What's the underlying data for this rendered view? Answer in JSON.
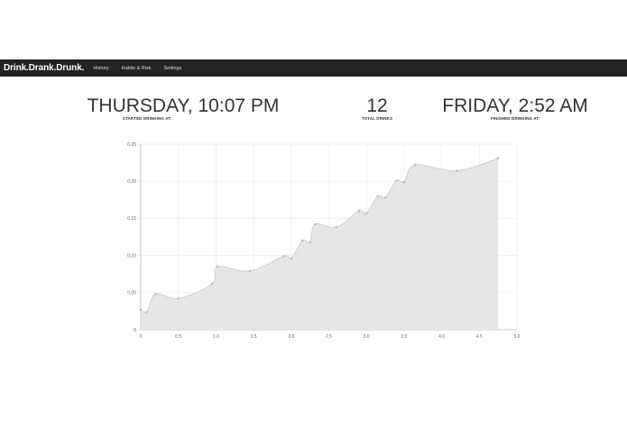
{
  "navbar": {
    "brand": "Drink.Drank.Drunk.",
    "links": [
      "History",
      "Habits & Risk",
      "Settings"
    ]
  },
  "stats": {
    "started": {
      "value": "THURSDAY, 10:07 PM",
      "label": "STARTED DRINKING AT:"
    },
    "total": {
      "value": "12",
      "label": "TOTAL DRINKS"
    },
    "finished": {
      "value": "FRIDAY, 2:52 AM",
      "label": "FINISHED DRINKING AT:"
    }
  },
  "colors": {
    "navbar": "#222222",
    "area_fill": "#e6e6e6",
    "line": "#cccccc",
    "grid": "#eeeeee"
  },
  "chart_data": {
    "type": "area",
    "xlim": [
      0,
      5
    ],
    "ylim": [
      0,
      0.25
    ],
    "x_ticks": [
      "0",
      "0.5",
      "1.0",
      "1.5",
      "2.0",
      "2.5",
      "3.0",
      "3.5",
      "4.0",
      "4.5",
      "5.0"
    ],
    "y_ticks": [
      "0",
      "0.05",
      "0.10",
      "0.15",
      "0.20",
      "0.25"
    ],
    "grid": true,
    "series": [
      {
        "x": [
          0,
          0.08,
          0.2,
          0.5,
          0.95,
          1.02,
          1.45,
          1.9,
          2.0,
          2.15,
          2.25,
          2.32,
          2.6,
          2.9,
          3.0,
          3.15,
          3.25,
          3.4,
          3.5,
          3.65,
          4.2,
          4.75
        ],
        "y": [
          0.027,
          0.024,
          0.048,
          0.042,
          0.062,
          0.085,
          0.079,
          0.099,
          0.096,
          0.12,
          0.118,
          0.142,
          0.138,
          0.16,
          0.157,
          0.18,
          0.178,
          0.201,
          0.199,
          0.222,
          0.214,
          0.231
        ]
      }
    ]
  }
}
